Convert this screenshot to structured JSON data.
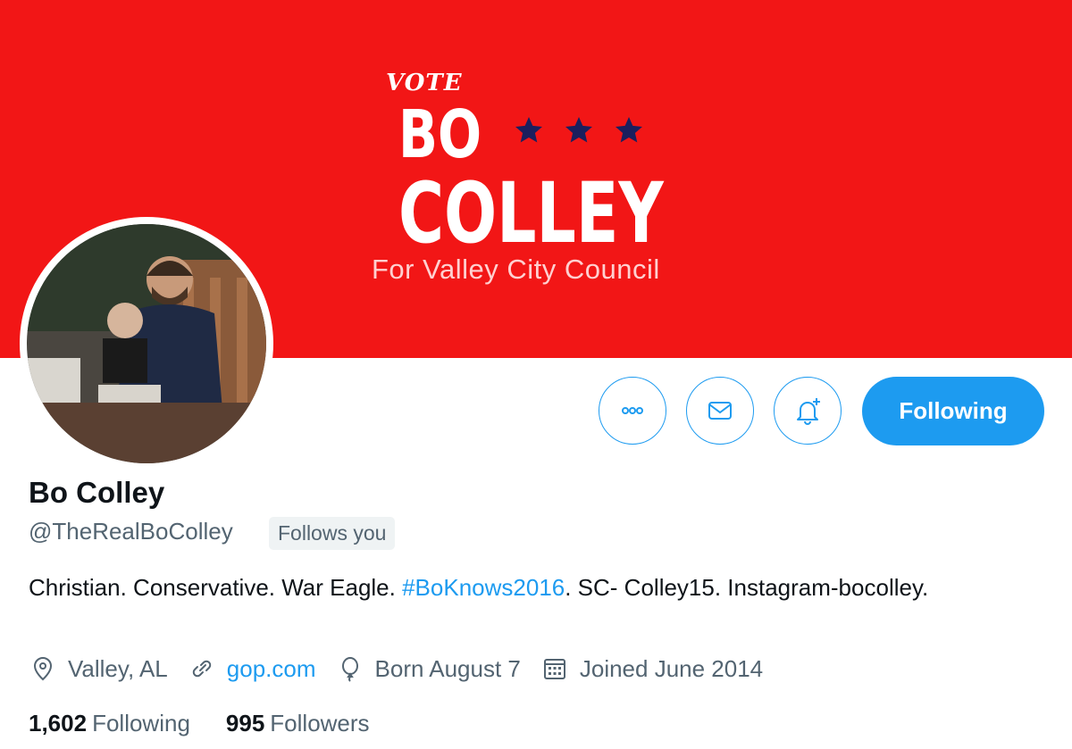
{
  "banner": {
    "vote": "VOTE",
    "line1": "BO",
    "line2": "COLLEY",
    "subtitle": "For Valley City Council",
    "bg_color": "#f21616",
    "star_color": "#1b1f5e"
  },
  "actions": {
    "more_icon": "more-icon",
    "message_icon": "message-icon",
    "notify_icon": "notification-bell-icon",
    "following_label": "Following"
  },
  "profile": {
    "name": "Bo Colley",
    "handle": "@TheRealBoColley",
    "follows_you": "Follows you",
    "bio_pre": "Christian. Conservative. War Eagle. ",
    "bio_tag": "#BoKnows2016",
    "bio_post": ". SC- Colley15. Instagram-bocolley.",
    "location": "Valley, AL",
    "website": "gop.com",
    "birthday": "Born August 7",
    "joined": "Joined June 2014"
  },
  "stats": {
    "following_count": "1,602",
    "following_label": "Following",
    "followers_count": "995",
    "followers_label": "Followers"
  },
  "colors": {
    "accent": "#1d9bf0",
    "muted": "#536471"
  }
}
